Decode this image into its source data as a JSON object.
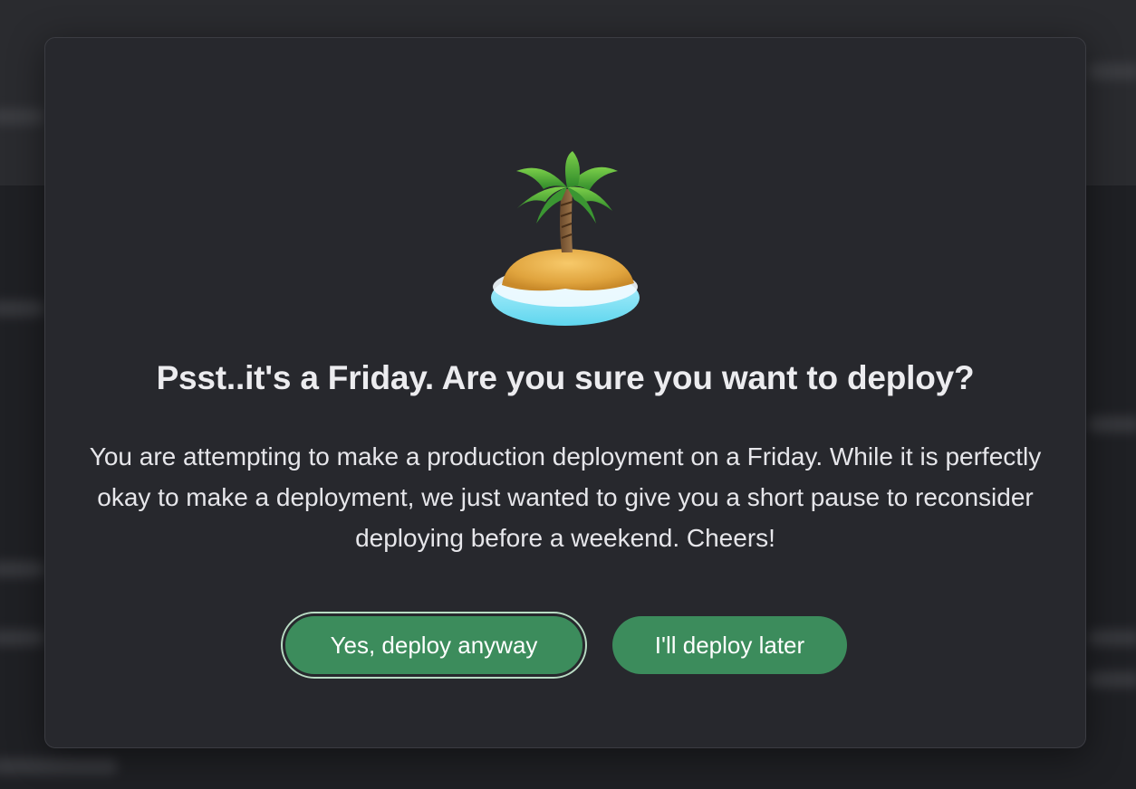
{
  "dialog": {
    "title": "Psst..it's a Friday. Are you sure you want to deploy?",
    "message": "You are attempting to make a production deployment on a Friday. While it is perfectly okay to make a deployment, we just wanted to give you a short pause to reconsider deploying before a weekend. Cheers!",
    "icon": "desert-island-icon",
    "confirm_label": "Yes, deploy anyway",
    "cancel_label": "I'll deploy later"
  },
  "colors": {
    "button_green": "#3c8c5c",
    "modal_background": "#27282d",
    "backdrop": "#1f2024"
  }
}
